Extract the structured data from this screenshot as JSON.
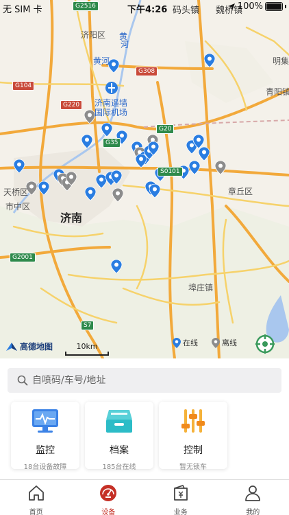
{
  "status_bar": {
    "carrier": "无 SIM 卡",
    "time": "下午4:26",
    "battery": "100%"
  },
  "map": {
    "labels": [
      {
        "text": "济阳区",
        "cls": ""
      },
      {
        "text": "黄河",
        "cls": "blue"
      },
      {
        "text": "济南遥墙国际机场",
        "cls": "blue"
      },
      {
        "text": "码头镇",
        "cls": ""
      },
      {
        "text": "魏桥镇",
        "cls": ""
      },
      {
        "text": "明集",
        "cls": ""
      },
      {
        "text": "青阳镇",
        "cls": ""
      },
      {
        "text": "天桥区",
        "cls": ""
      },
      {
        "text": "市中区",
        "cls": ""
      },
      {
        "text": "济南",
        "cls": "big"
      },
      {
        "text": "章丘区",
        "cls": ""
      },
      {
        "text": "埠庄镇",
        "cls": ""
      },
      {
        "text": "黄",
        "cls": "blue"
      },
      {
        "text": "河",
        "cls": "blue"
      }
    ],
    "road_tags": [
      {
        "text": "G2516",
        "color": "green"
      },
      {
        "text": "G308",
        "color": "red"
      },
      {
        "text": "G104",
        "color": "red"
      },
      {
        "text": "G220",
        "color": "red"
      },
      {
        "text": "G20",
        "color": "green"
      },
      {
        "text": "G35",
        "color": "green"
      },
      {
        "text": "S0101",
        "color": "green"
      },
      {
        "text": "G2001",
        "color": "green"
      },
      {
        "text": "S7",
        "color": "green"
      }
    ],
    "logo_text": "高德地图",
    "scale_label": "10km",
    "legend": {
      "online": "在线",
      "offline": "离线"
    },
    "colors": {
      "online_marker": "#2a7de1",
      "offline_marker": "#8c8c8c",
      "highway": "#f2a93b",
      "land": "#f4f1ea"
    }
  },
  "search": {
    "placeholder": "自喷码/车号/地址"
  },
  "cards": [
    {
      "title": "监控",
      "sub": "18台设备故障",
      "icon": "monitor-icon"
    },
    {
      "title": "档案",
      "sub": "185台在线",
      "icon": "archive-icon"
    },
    {
      "title": "控制",
      "sub": "暂无锁车",
      "icon": "control-sliders-icon"
    }
  ],
  "tabs": [
    {
      "label": "首页",
      "icon": "home-icon",
      "active": false
    },
    {
      "label": "设备",
      "icon": "device-dashboard-icon",
      "active": true
    },
    {
      "label": "业务",
      "icon": "business-wallet-icon",
      "active": false
    },
    {
      "label": "我的",
      "icon": "user-icon",
      "active": false
    }
  ]
}
